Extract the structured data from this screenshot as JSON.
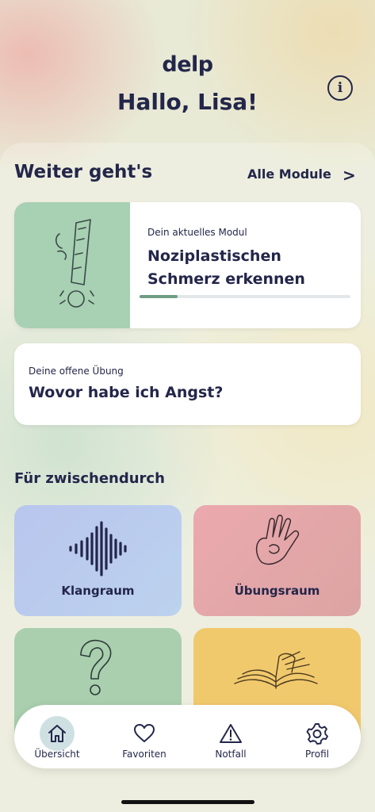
{
  "header": {
    "logo": "delp",
    "greeting": "Hallo, Lisa!",
    "info_icon": "info-icon"
  },
  "continue_section": {
    "title": "Weiter geht's",
    "all_modules_label": "Alle Module",
    "chevron_icon": "chevron-right-icon"
  },
  "current_module": {
    "caption": "Dein aktuelles Modul",
    "title": "Noziplastischen Schmerz erkennen",
    "progress": 0.18,
    "illustration": "exclamation-illustration",
    "image_color": "#a8d0b2",
    "progress_color": "#6f9d84"
  },
  "open_exercise": {
    "caption": "Deine offene Übung",
    "title": "Wovor habe ich Angst?"
  },
  "between": {
    "title": "Für zwischendurch",
    "tiles": [
      {
        "label": "Klangraum",
        "icon": "sound-wave-icon",
        "color": "#b9c5ee"
      },
      {
        "label": "Übungsraum",
        "icon": "hand-icon",
        "color": "#eba9ae"
      },
      {
        "label": "",
        "icon": "question-mark-icon",
        "color": "#a9cfae"
      },
      {
        "label": "",
        "icon": "open-book-icon",
        "color": "#f1c96d"
      }
    ]
  },
  "tab_bar": {
    "items": [
      {
        "label": "Übersicht",
        "icon": "home-icon",
        "active": true
      },
      {
        "label": "Favoriten",
        "icon": "heart-icon",
        "active": false
      },
      {
        "label": "Notfall",
        "icon": "warning-icon",
        "active": false
      },
      {
        "label": "Profil",
        "icon": "gear-icon",
        "active": false
      }
    ]
  }
}
